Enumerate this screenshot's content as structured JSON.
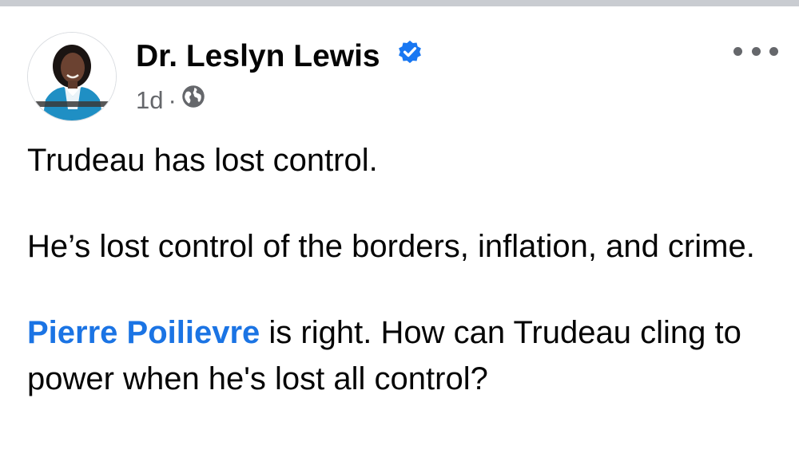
{
  "post": {
    "author": "Dr. Leslyn Lewis",
    "timestamp": "1d",
    "separator": "·",
    "privacy_icon": "globe-icon",
    "verified_icon": "verified-badge-icon",
    "more_icon": "more-options-icon",
    "paragraphs": [
      "Trudeau has lost control.",
      "He’s lost control of the borders, inflation, and crime."
    ],
    "mention": "Pierre Poilievre",
    "mention_suffix": " is right. How can Trudeau cling to power when he's lost all control?"
  },
  "colors": {
    "text": "#050505",
    "secondary": "#65676b",
    "link": "#1b74e4",
    "verified": "#1877f2",
    "avatar_jacket": "#1f8fc4"
  }
}
